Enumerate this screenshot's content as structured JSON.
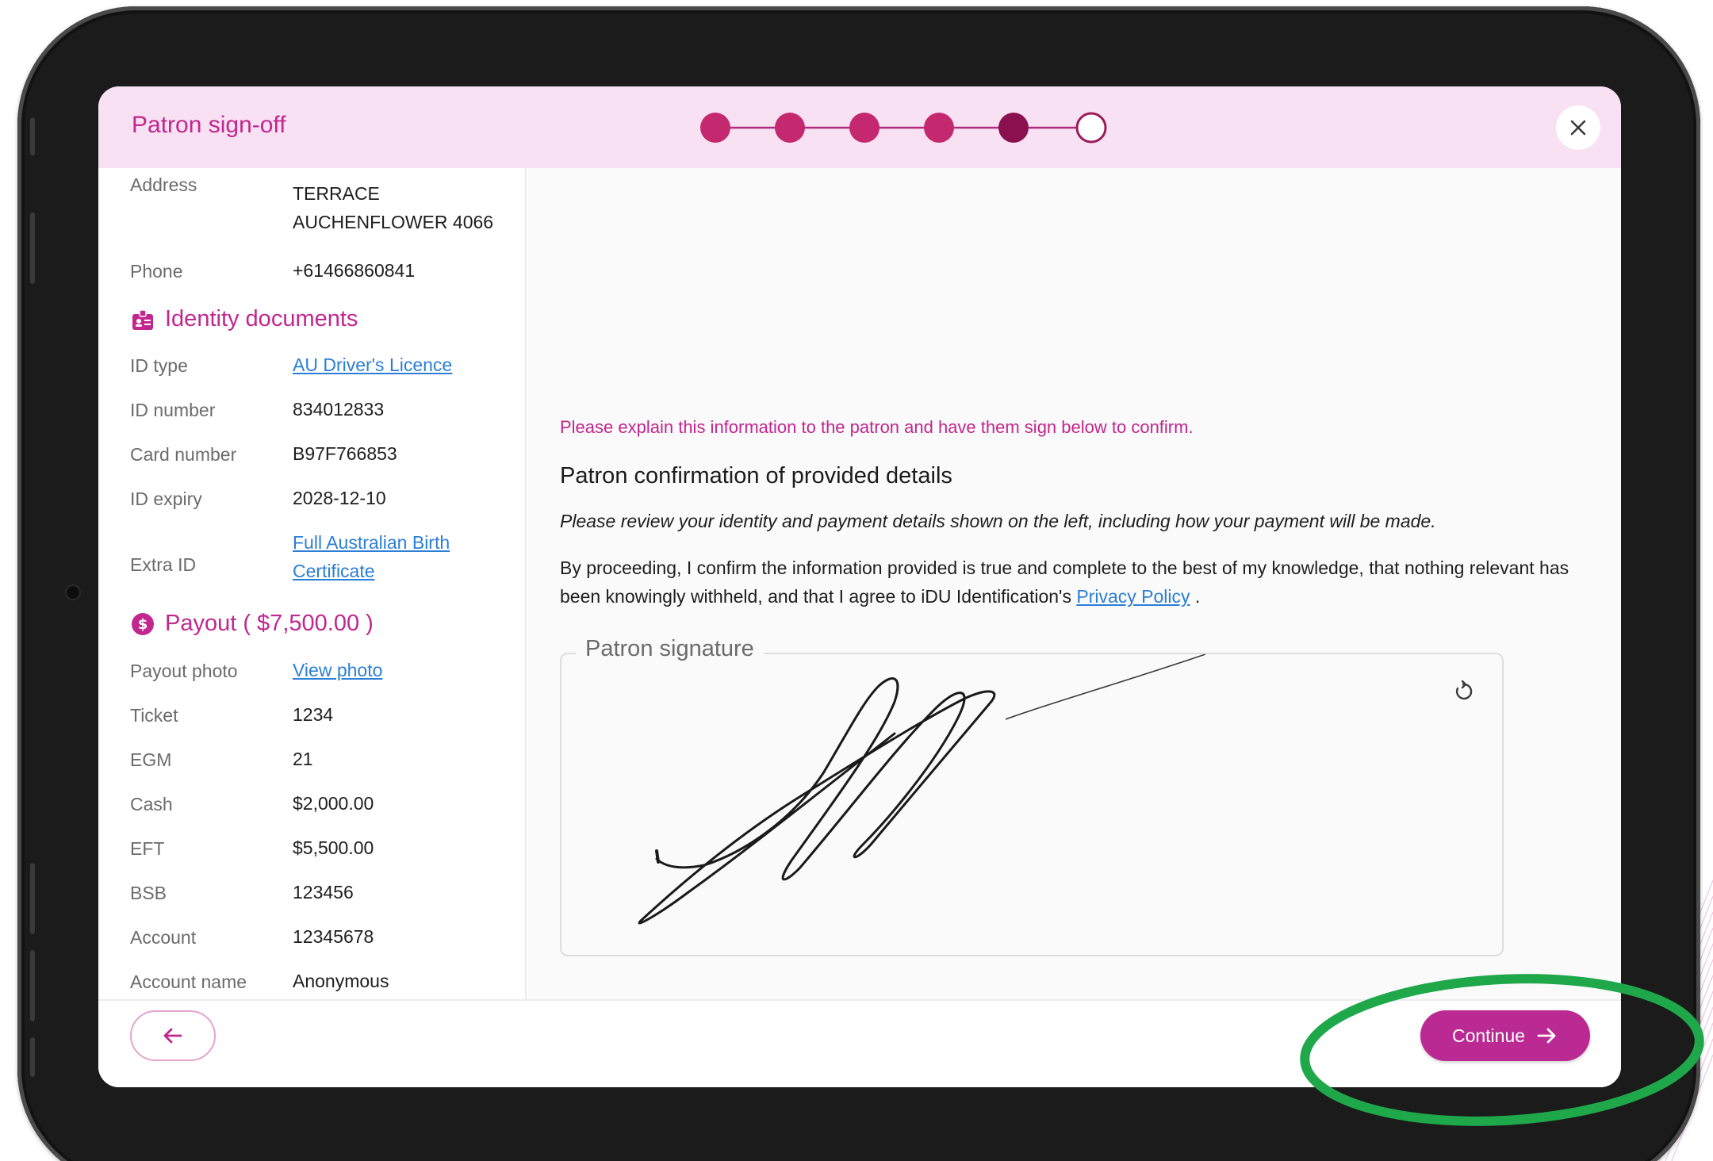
{
  "header": {
    "title": "Patron sign-off",
    "steps": {
      "total": 6,
      "current": 5
    }
  },
  "left_panel": {
    "address": {
      "label": "Address",
      "line1": "TERRACE",
      "line2": "AUCHENFLOWER 4066"
    },
    "phone": {
      "label": "Phone",
      "value": "+61466860841"
    },
    "identity_section": "Identity documents",
    "id_type": {
      "label": "ID type",
      "value": "AU Driver's Licence"
    },
    "id_number": {
      "label": "ID number",
      "value": "834012833"
    },
    "card_number": {
      "label": "Card number",
      "value": "B97F766853"
    },
    "id_expiry": {
      "label": "ID expiry",
      "value": "2028-12-10"
    },
    "extra_id": {
      "label": "Extra ID",
      "line1": "Full Australian Birth",
      "line2": "Certificate"
    },
    "payout_section": "Payout ( $7,500.00 )",
    "payout_photo": {
      "label": "Payout photo",
      "value": "View photo"
    },
    "ticket": {
      "label": "Ticket",
      "value": "1234"
    },
    "egm": {
      "label": "EGM",
      "value": "21"
    },
    "cash": {
      "label": "Cash",
      "value": "$2,000.00"
    },
    "eft": {
      "label": "EFT",
      "value": "$5,500.00"
    },
    "bsb": {
      "label": "BSB",
      "value": "123456"
    },
    "account": {
      "label": "Account",
      "value": "12345678"
    },
    "account_name": {
      "label": "Account name",
      "value": "Anonymous"
    }
  },
  "right_panel": {
    "instruction": "Please explain this information to the patron and have them sign below to confirm.",
    "confirm_title": "Patron confirmation of provided details",
    "review_note": "Please review your identity and payment details shown on the left, including how your payment will be made.",
    "consent_text": "By proceeding, I confirm the information provided is true and complete to the best of my knowledge, that nothing relevant has been knowingly withheld, and that I agree to iDU Identification's",
    "privacy_link": "Privacy Policy",
    "consent_end": ".",
    "signature_label": "Patron signature"
  },
  "footer": {
    "continue_label": "Continue"
  },
  "colors": {
    "accent": "#c2268f",
    "button": "#bb2a92",
    "header_bg": "#f8e1f2",
    "link": "#2b7fd6",
    "highlight": "#1fa84a"
  },
  "icons": [
    "close-icon",
    "id-badge-icon",
    "dollar-circle-icon",
    "reset-icon",
    "arrow-left-icon",
    "arrow-right-icon"
  ]
}
